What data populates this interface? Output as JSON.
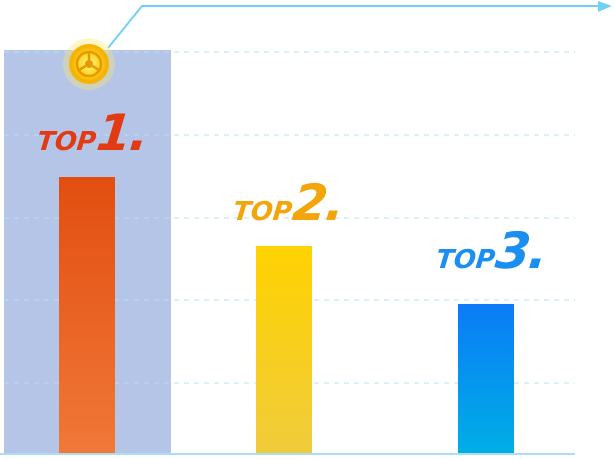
{
  "chart_data": {
    "type": "bar",
    "categories": [
      "TOP1.",
      "TOP2.",
      "TOP3."
    ],
    "values": [
      100,
      75,
      54
    ],
    "ylim": [
      0,
      100
    ],
    "grid": true,
    "highlight_index": 0,
    "colors": {
      "top1": [
        "#e24e10",
        "#f07838"
      ],
      "top2": [
        "#ffd200",
        "#f0cc3c"
      ],
      "top3": [
        "#0a7cf6",
        "#00aee6"
      ],
      "highlight": "#b4c5e8",
      "grid": "#b9e0f2",
      "accent_line": "#6fd2f5"
    }
  },
  "labels": [
    {
      "word": "TOP",
      "num": "1",
      "dot": "."
    },
    {
      "word": "TOP",
      "num": "2",
      "dot": "."
    },
    {
      "word": "TOP",
      "num": "3",
      "dot": "."
    }
  ],
  "icons": {
    "medal": "gold-medal-icon"
  }
}
